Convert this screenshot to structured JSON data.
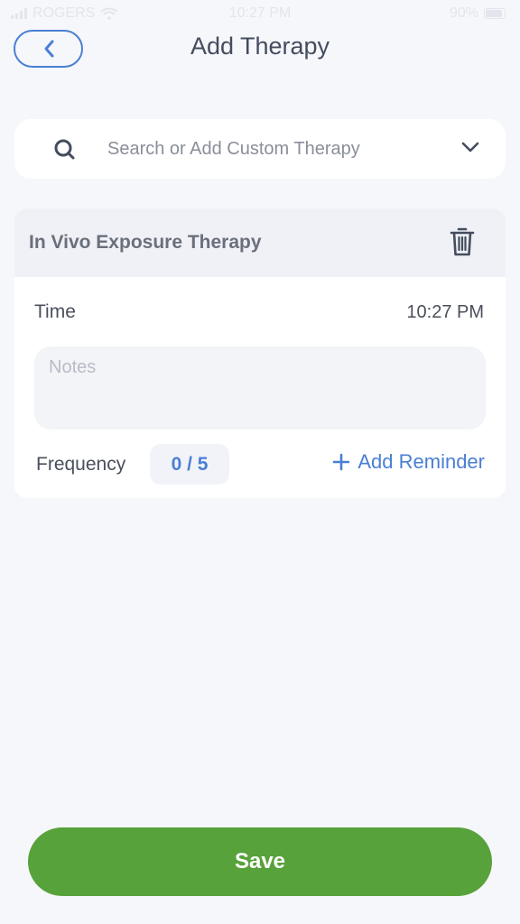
{
  "status_bar": {
    "carrier": "ROGERS",
    "time": "10:27 PM",
    "battery": "90%"
  },
  "header": {
    "title": "Add Therapy",
    "back_icon": "chevron-left-icon"
  },
  "search": {
    "placeholder": "Search or Add Custom Therapy",
    "icon": "search-icon",
    "dropdown_icon": "chevron-down-icon"
  },
  "therapy": {
    "name": "In Vivo Exposure Therapy",
    "delete_icon": "trash-icon",
    "time_label": "Time",
    "time_value": "10:27 PM",
    "notes_placeholder": "Notes",
    "frequency_label": "Frequency",
    "frequency_value": "0 / 5",
    "add_reminder_label": "Add Reminder"
  },
  "actions": {
    "save_label": "Save"
  },
  "colors": {
    "accent": "#4a7fd4",
    "save": "#57a23a",
    "background": "#f6f7fb"
  }
}
